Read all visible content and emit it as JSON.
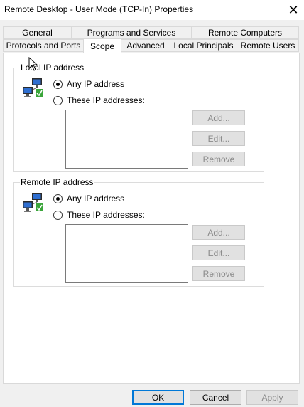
{
  "window": {
    "title": "Remote Desktop - User Mode (TCP-In) Properties"
  },
  "tabs": {
    "row1": [
      {
        "label": "General"
      },
      {
        "label": "Programs and Services"
      },
      {
        "label": "Remote Computers"
      }
    ],
    "row2": [
      {
        "label": "Protocols and Ports"
      },
      {
        "label": "Scope",
        "selected": true
      },
      {
        "label": "Advanced"
      },
      {
        "label": "Local Principals"
      },
      {
        "label": "Remote Users"
      }
    ]
  },
  "local": {
    "group_label": "Local IP address",
    "any_label": "Any IP address",
    "these_label": "These IP addresses:",
    "selected": "any",
    "add_label": "Add...",
    "edit_label": "Edit...",
    "remove_label": "Remove"
  },
  "remote": {
    "group_label": "Remote IP address",
    "any_label": "Any IP address",
    "these_label": "These IP addresses:",
    "selected": "any",
    "add_label": "Add...",
    "edit_label": "Edit...",
    "remove_label": "Remove"
  },
  "footer": {
    "ok_label": "OK",
    "cancel_label": "Cancel",
    "apply_label": "Apply"
  },
  "colors": {
    "panel": "#ffffff",
    "dialog": "#f0f0f0",
    "default_button_border": "#0078d7",
    "disabled_text": "#8a8a8a"
  }
}
